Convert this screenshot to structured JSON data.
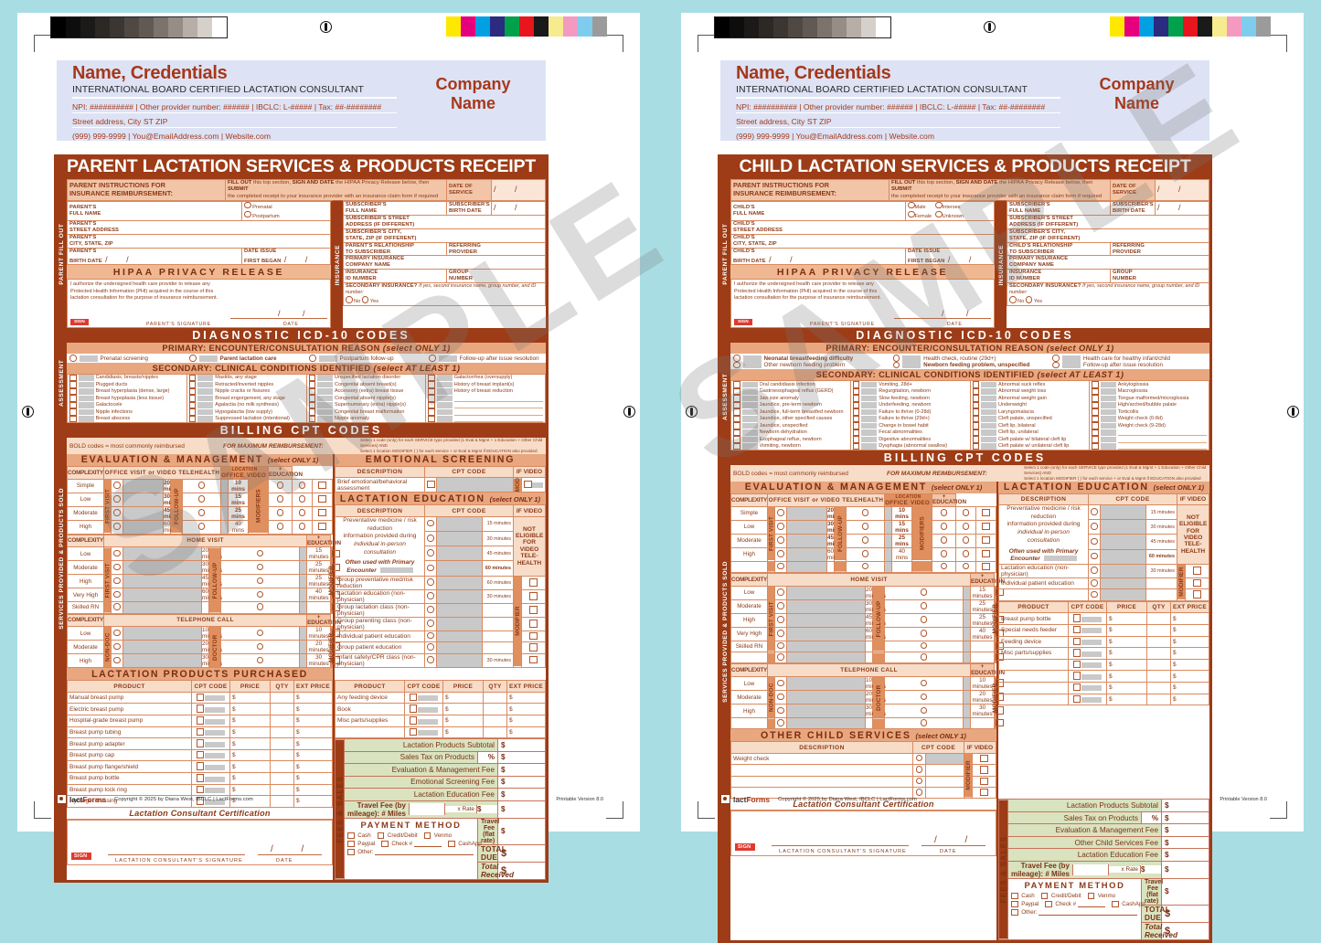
{
  "colors": {
    "brand": "#9d3c16",
    "accent": "#e8a77f",
    "pale": "#f7dcc8",
    "green": "#d9e3c0",
    "letterhead": "#dde3f5"
  },
  "calibration": {
    "grey_steps": [
      "#000000",
      "#0d0d0d",
      "#1b1a18",
      "#2c2824",
      "#3b3632",
      "#4f4843",
      "#615a54",
      "#7b736c",
      "#968d86",
      "#b6aea7",
      "#d6d0ca",
      "#ffffff"
    ],
    "color_steps": [
      "#ffe800",
      "#e6007e",
      "#00a0e3",
      "#2b2b7f",
      "#00a14b",
      "#e8151d",
      "#1a1a1a",
      "#f6eb8f",
      "#f49ac1",
      "#7fcdee",
      "#9b9b9b"
    ]
  },
  "letterhead": {
    "name": "Name, Credentials",
    "subtitle": "INTERNATIONAL BOARD CERTIFIED LACTATION CONSULTANT",
    "line1": "NPI: ########## | Other provider number: ###### | IBCLC: L-##### | Tax:  ##-########",
    "line2": "Street address, City ST ZIP",
    "line3": "(999) 999-9999 | You@EmailAddress.com | Website.com",
    "company": "Company\nName"
  },
  "common": {
    "rails": {
      "fillout": "PARENT FILL OUT",
      "insurance": "INSURANCE",
      "assessment": "ASSESSMENT",
      "services": "SERVICES PROVIDED & PRODUCTS SOLD",
      "fees": "FEES & SALES"
    },
    "instructions": {
      "label1": "PARENT INSTRUCTIONS FOR",
      "label2": "INSURANCE REIMBURSEMENT:",
      "text_a": "FILL OUT",
      "text_b": " this top section, ",
      "text_c": "SIGN AND DATE",
      "text_d": " the HIPAA Privacy Release below, then ",
      "text_e": "SUBMIT",
      "text_f": "the completed receipt to your insurance provider with an insurance claim form if required",
      "date_of_service": "DATE OF\nSERVICE"
    },
    "insurance_fields": {
      "subscriber_full_name": "SUBSCRIBER'S\nFULL NAME",
      "subscriber_birth_date": "SUBSCRIBER'S\nBIRTH DATE",
      "subscriber_street": "SUBSCRIBER'S STREET\nADDRESS (if different)",
      "subscriber_city": "SUBSCRIBER'S CITY,\nSTATE, ZIP (if different)",
      "referring_provider": "REFERRING\nPROVIDER",
      "primary_insurance": "PRIMARY INSURANCE\nCOMPANY NAME",
      "insurance_id": "INSURANCE\nID NUMBER",
      "group_number": "GROUP\nNUMBER",
      "secondary": "SECONDARY INSURANCE?",
      "secondary_note": "If yes, second insurance name, group number, and ID number:",
      "secondary_no": "No",
      "secondary_yes": "Yes"
    },
    "hipaa": {
      "title": "HIPAA PRIVACY RELEASE",
      "body": "I authorize the undersigned health care provider to release any Protected Health Information (PHI) acquired in the course of this lactation consultation for the purpose of insurance reimbursement.",
      "sign_tag": "SIGN",
      "signature_label": "PARENT'S SIGNATURE",
      "date_label": "DATE"
    },
    "icd_title": "DIAGNOSTIC ICD-10 CODES",
    "primary_title": "PRIMARY:  ENCOUNTER/CONSULTATION REASON",
    "primary_select": "(select ONLY 1)",
    "secondary_title": "SECONDARY:  CLINICAL CONDITIONS IDENTIFIED",
    "secondary_select": "(select AT LEAST 1)",
    "billing_title": "BILLING CPT CODES",
    "bold_note": "BOLD codes = most commonly reimbursed",
    "max_reimb": "FOR MAXIMUM REIMBURSEMENT:",
    "max_reimb_fine1": "Select 1 code (only) for each SERVICE type provided (1 Eval & Mgmt + 1 Education + Other Child Services) AND",
    "max_reimb_fine2": "Select 1 location MODIFIER (                ) for each service +           or Eval & Mgmt if EDUCATION also provided",
    "em_title": "EVALUATION & MANAGEMENT",
    "em_select": "(select ONLY 1)",
    "em_complexity": "COMPLEXITY",
    "em_office": "OFFICE VISIT or VIDEO TELEHEALTH",
    "em_location": "LOCATION",
    "em_loc_office": "OFFICE",
    "em_loc_video": "VIDEO",
    "em_plus_education": "+\nEDUCATION",
    "em_modifiers": "MODIFIERS",
    "em_first_visit": "FIRST VISIT",
    "em_follow_up": "FOLLOW-UP",
    "em_rows": [
      "Simple",
      "Low",
      "Moderate",
      "High"
    ],
    "em_first_mins": [
      "20 mins",
      "30 mins",
      "45 mins",
      "60 mins"
    ],
    "em_follow_mins": [
      "10 mins",
      "15 mins",
      "25 mins",
      "40 mins"
    ],
    "home_title": "HOME VISIT",
    "home_rows": [
      "Low",
      "Moderate",
      "High",
      "Very High",
      "Skilled RN"
    ],
    "home_first_mins": [
      "20 minutes",
      "30 minutes",
      "45 minutes",
      "60 minutes",
      ""
    ],
    "home_follow_mins": [
      "15 minutes",
      "25 minutes",
      "25 minutes",
      "40 minutes",
      ""
    ],
    "home_modifier": "MODIFIER",
    "phone_title": "TELEPHONE CALL",
    "phone_rows": [
      "Low",
      "Moderate",
      "High"
    ],
    "phone_nondoc": "NON-DOC",
    "phone_doctor": "DOCTOR",
    "phone_mins_left": [
      "10 minutes",
      "20 minutes",
      "30 minutes"
    ],
    "phone_mins_right": [
      "10 minutes",
      "20 minutes",
      "30 minutes"
    ],
    "lact_edu_title": "LACTATION EDUCATION",
    "lact_edu_select": "(select ONLY 1)",
    "hdr_description": "DESCRIPTION",
    "hdr_cpt": "CPT CODE",
    "hdr_ifvideo": "IF VIDEO",
    "edu_prev_line1": "Preventative medicine / risk reduction",
    "edu_prev_line2": "information provided during",
    "edu_prev_line3": "individual in-person consultation",
    "edu_prev_note": "Often used with Primary Encounter",
    "edu_prev_mins": [
      "15 minutes",
      "30 minutes",
      "45 minutes",
      "60 minutes"
    ],
    "not_eligible": "NOT\nELIGIBLE\nFOR\nVIDEO\nTELE-\nHEALTH",
    "modifier": "MODIFIER",
    "products_title": "LACTATION PRODUCTS PURCHASED",
    "hdr_product": "PRODUCT",
    "hdr_price": "PRICE",
    "hdr_qty": "QTY",
    "hdr_ext": "EXT PRICE",
    "cert_title": "Lactation Consultant Certification",
    "cert_signature": "LACTATION CONSULTANT'S SIGNATURE",
    "cert_date": "DATE",
    "fees": {
      "subtotal": "Lactation Products Subtotal",
      "sales_tax": "Sales Tax on Products",
      "pct": "%",
      "em_fee": "Evaluation & Management Fee",
      "lact_edu_fee": "Lactation Education Fee",
      "travel_mileage": "Travel Fee (by mileage):  # Miles",
      "travel_rate": "x Rate",
      "travel_flat": "Travel Fee (flat rate)",
      "total_due": "TOTAL DUE",
      "total_received": "Total Received",
      "dollar": "$"
    },
    "payment": {
      "title": "PAYMENT METHOD",
      "options": [
        "Cash",
        "Credit/Debit",
        "Venmo",
        "Paypal",
        "Check #",
        "CashApp",
        "Other:"
      ]
    },
    "footer": {
      "logo": "lactForms",
      "copyright": "Copyright © 2025 by Diana West, IBCLC  |  LactForms.com",
      "version": "Printable Version 8.0"
    },
    "watermark": "SAMPLE"
  },
  "parent": {
    "title": "PARENT LACTATION SERVICES & PRODUCTS RECEIPT",
    "fields": {
      "full_name": "PARENT'S\nFULL NAME",
      "street": "PARENT'S\nSTREET ADDRESS",
      "city": "PARENT'S\nCITY, STATE, ZIP",
      "birth_date": "PARENT'S\nBIRTH DATE",
      "date_issue": "DATE ISSUE\nFIRST BEGAN",
      "relationship": "PARENT'S RELATIONSHIP\nTO SUBSCRIBER"
    },
    "status_options": [
      "Prenatal",
      "Postpartum"
    ],
    "primary_reasons": [
      "Prenatal screening",
      "Parent lactation care",
      "Postpartum follow-up",
      "Follow-up after issue resolution"
    ],
    "primary_bold_index": 1,
    "secondary_columns": [
      [
        "Candidiasis, breasts/nipples",
        "Plugged ducts",
        "Breast hyperplasia (dense, large)",
        "Breast hypoplasia (less tissue)",
        "Galactocele",
        "Nipple infections",
        "Breast abscess"
      ],
      [
        "Mastitis, any stage",
        "Retracted/inverted nipples",
        "Nipple cracks or fissures",
        "Breast engorgement, any stage",
        "Agalactia (no milk synthesis)",
        "Hypogalactia (low supply)",
        "Suppressed lactation (intentional)"
      ],
      [
        "Unspecified lactation disorder",
        "Congenital absent breast(s)",
        "Accessory (extra) breast tissue",
        "Congenital absent nipple(s)",
        "Supernumerary (extra) nipple(s)",
        "Congenital breast malformation",
        "Nipple anomaly"
      ],
      [
        "Galactorrhea (oversupply)",
        "History of breast implant(s)",
        "History of breast reduction",
        "",
        "",
        "",
        ""
      ]
    ],
    "emotional_title": "EMOTIONAL SCREENING",
    "emotional_row": "Brief emotional/behavioral assessment",
    "emotional_mod": "MOD",
    "edu_rows": [
      "Group preventative med/risk reduction",
      "Lactation education (non-physician)",
      "Group lactation class (non-physician)",
      "Group parenting class (non-physician)",
      "Individual patient education",
      "Group patient education",
      "Infant safety/CPR class (non-physician)"
    ],
    "edu_row_mins": [
      "60 minutes",
      "30 minutes",
      "",
      "",
      "",
      "",
      "30 minutes"
    ],
    "products_left": [
      "Manual breast pump",
      "Electric breast pump",
      "Hospital-grade breast pump",
      "Breast pump tubing",
      "Breast pump adapter",
      "Breast pump cap",
      "Breast pump flange/shield",
      "Breast pump bottle",
      "Breast pump lock ring",
      "Hydrogel dressing"
    ],
    "products_right": [
      "Any feeding device",
      "Book",
      "Misc parts/supplies",
      ""
    ],
    "fee_rows": [
      "Lactation Products Subtotal",
      "Sales Tax on Products",
      "Evaluation & Management Fee",
      "Emotional Screening Fee",
      "Lactation Education Fee"
    ]
  },
  "child": {
    "title": "CHILD LACTATION SERVICES & PRODUCTS RECEIPT",
    "fields": {
      "full_name": "CHILD'S\nFULL NAME",
      "street": "CHILD'S\nSTREET ADDRESS",
      "city": "CHILD'S\nCITY, STATE, ZIP",
      "birth_date": "CHILD'S\nBIRTH DATE",
      "date_issue": "DATE ISSUE\nFIRST BEGAN",
      "relationship": "CHILD'S RELATIONSHIP\nTO SUBSCRIBER"
    },
    "sex_options": [
      "Male",
      "Intersex",
      "Female",
      "Unknown"
    ],
    "primary_reasons": [
      "Neonatal breastfeeding difficulty",
      "Other newborn feeding problem",
      "Health check, routine (29d+)",
      "Newborn feeding problem, unspecified",
      "Health care for healthy infant/child",
      "Follow-up after issue resolution"
    ],
    "secondary_columns": [
      [
        "Oral candidiasis infection",
        "Gastroesophageal reflux (GERD)",
        "Jaw size anomaly",
        "Jaundice, pre-term newborn",
        "Jaundice, full-term breastfed newborn",
        "Jaundice, other specified causes",
        "Jaundice, unspecified",
        "Newborn dehydration",
        "Esophageal reflux, newborn",
        "Vomiting, newborn"
      ],
      [
        "Vomiting, 28d+",
        "Regurgitation, newborn",
        "Slow feeding, newborn",
        "Underfeeding, newborn",
        "Failure to thrive (0-28d)",
        "Failure to thrive (29d+)",
        "Change in bowel habit",
        "Fecal abnormalities",
        "Digestive abnormalities",
        "Dysphagia (abnormal swallow)"
      ],
      [
        "Abnormal suck reflex",
        "Abnormal weight loss",
        "Abnormal weight gain",
        "Underweight",
        "Laryngomalacia",
        "Cleft palate, unspecified",
        "Cleft lip, bilateral",
        "Cleft lip, unilateral",
        "Cleft palate w/ bilateral cleft lip",
        "Cleft palate w/ unilateral cleft lip"
      ],
      [
        "Ankyloglossia",
        "Macroglossia",
        "Tongue malformed/microglossia",
        "High/arched/bubble palate",
        "Torticollis",
        "Weight check (0-8d)",
        "Weight check (9-28d)",
        "",
        "",
        ""
      ]
    ],
    "edu_rows": [
      "Lactation education (non-physician)",
      "Individual patient education",
      ""
    ],
    "edu_row_mins": [
      "30 minutes",
      "",
      ""
    ],
    "other_services_title": "OTHER CHILD SERVICES",
    "other_services_select": "(select ONLY 1)",
    "other_services_rows": [
      "Weight check",
      "",
      "",
      ""
    ],
    "products_right": [
      "Breast pump bottle",
      "Special needs feeder",
      "Feeding device",
      "Misc parts/supplies",
      "",
      "",
      "",
      ""
    ],
    "fee_rows": [
      "Lactation Products Subtotal",
      "Sales Tax on Products",
      "Evaluation & Management Fee",
      "Other Child Services Fee",
      "Lactation Education Fee"
    ]
  }
}
